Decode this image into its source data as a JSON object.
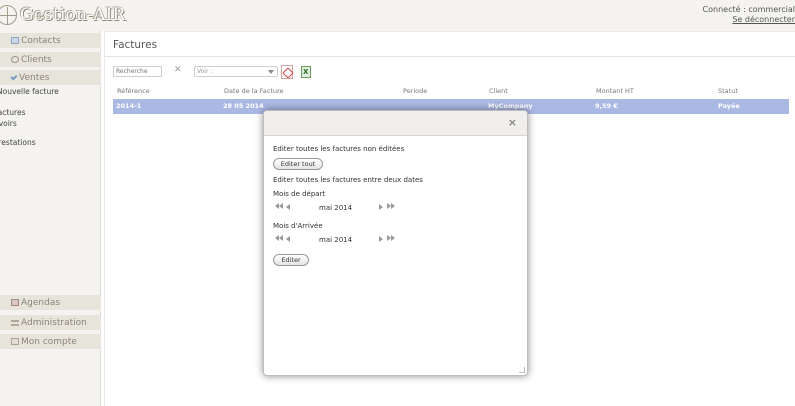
{
  "header": {
    "app_title": "Gestion-AIR",
    "connected_label": "Connecté : commercial",
    "logout_label": "Se déconnecter"
  },
  "sidebar": {
    "top_items": [
      {
        "label": "Contacts",
        "icon": "contacts-icon"
      },
      {
        "label": "Clients",
        "icon": "clients-icon"
      },
      {
        "label": "Ventes",
        "icon": "ventes-icon"
      }
    ],
    "sub_items": [
      {
        "label": "Nouvelle facture"
      },
      {
        "label": "Factures"
      },
      {
        "label": "Avoirs"
      },
      {
        "label": "Prestations"
      }
    ],
    "bottom_items": [
      {
        "label": "Agendas",
        "icon": "calendar-icon"
      },
      {
        "label": "Administration",
        "icon": "admin-icon"
      },
      {
        "label": "Mon compte",
        "icon": "account-icon"
      }
    ]
  },
  "main": {
    "title": "Factures",
    "search_placeholder": "Recherche",
    "search_clear": "✕",
    "view_select": "Voir :",
    "table": {
      "columns": [
        "Référence",
        "Date de la Facture",
        "Periode",
        "Client",
        "Montant HT",
        "Statut"
      ],
      "rows": [
        {
          "reference": "2014-1",
          "date": "28 05 2014",
          "periode": "",
          "client": "MyCompany",
          "montant": "9,59 €",
          "statut": "Payée"
        }
      ]
    }
  },
  "dialog": {
    "close_label": "×",
    "text_unedited": "Editer toutes les factures non éditées",
    "btn_edit_all": "Editer tout",
    "text_between_dates": "Editer toutes les factures entre deux dates",
    "label_start": "Mois de départ",
    "start_month": "mai 2014",
    "label_end": "Mois d'Arrivée",
    "end_month": "mai 2014",
    "btn_edit": "Editer"
  },
  "colors": {
    "selected_row": "#aab8e4",
    "sidebar_bg": "#f4f3ef",
    "sidebar_block": "#e7e4dc"
  }
}
